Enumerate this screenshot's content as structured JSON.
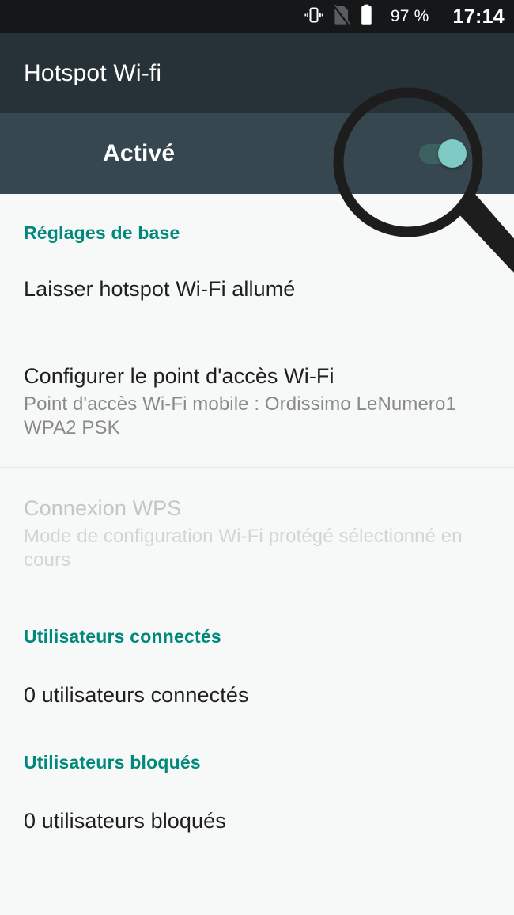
{
  "statusbar": {
    "vibrate_icon": "vibrate-icon",
    "sim_off_icon": "sim-card-off-icon",
    "battery_icon": "battery-full-icon",
    "battery_text": "97 %",
    "clock": "17:14"
  },
  "appbar": {
    "title": "Hotspot Wi-fi"
  },
  "switchbar": {
    "label": "Activé",
    "toggle_state": "on",
    "toggle_thumb_color": "#7fcac4",
    "toggle_track_color": "#3e6160"
  },
  "overlay": {
    "magnifier_icon": "magnifier-icon",
    "color": "#1d1d1d"
  },
  "theme": {
    "accent": "#00897b",
    "appbar_bg": "#263238",
    "switchbar_bg": "#37474f",
    "statusbar_bg": "#161719",
    "content_bg": "#f7f8f8",
    "divider": "#e4e6e7"
  },
  "sections": [
    {
      "header": "Réglages de base",
      "rows": [
        {
          "title": "Laisser hotspot Wi-Fi allumé",
          "sub": "",
          "disabled": false
        },
        {
          "title": "Configurer le point d'accès Wi-Fi",
          "sub": "Point d'accès Wi-Fi mobile : Ordissimo LeNumero1 WPA2 PSK",
          "disabled": false
        },
        {
          "title": "Connexion WPS",
          "sub": "Mode de configuration Wi-Fi protégé sélectionné en cours",
          "disabled": true
        }
      ]
    },
    {
      "header": "Utilisateurs connectés",
      "rows": [
        {
          "title": "0 utilisateurs connectés",
          "sub": "",
          "disabled": false
        }
      ]
    },
    {
      "header": "Utilisateurs bloqués",
      "rows": [
        {
          "title": "0 utilisateurs bloqués",
          "sub": "",
          "disabled": false
        }
      ]
    }
  ]
}
